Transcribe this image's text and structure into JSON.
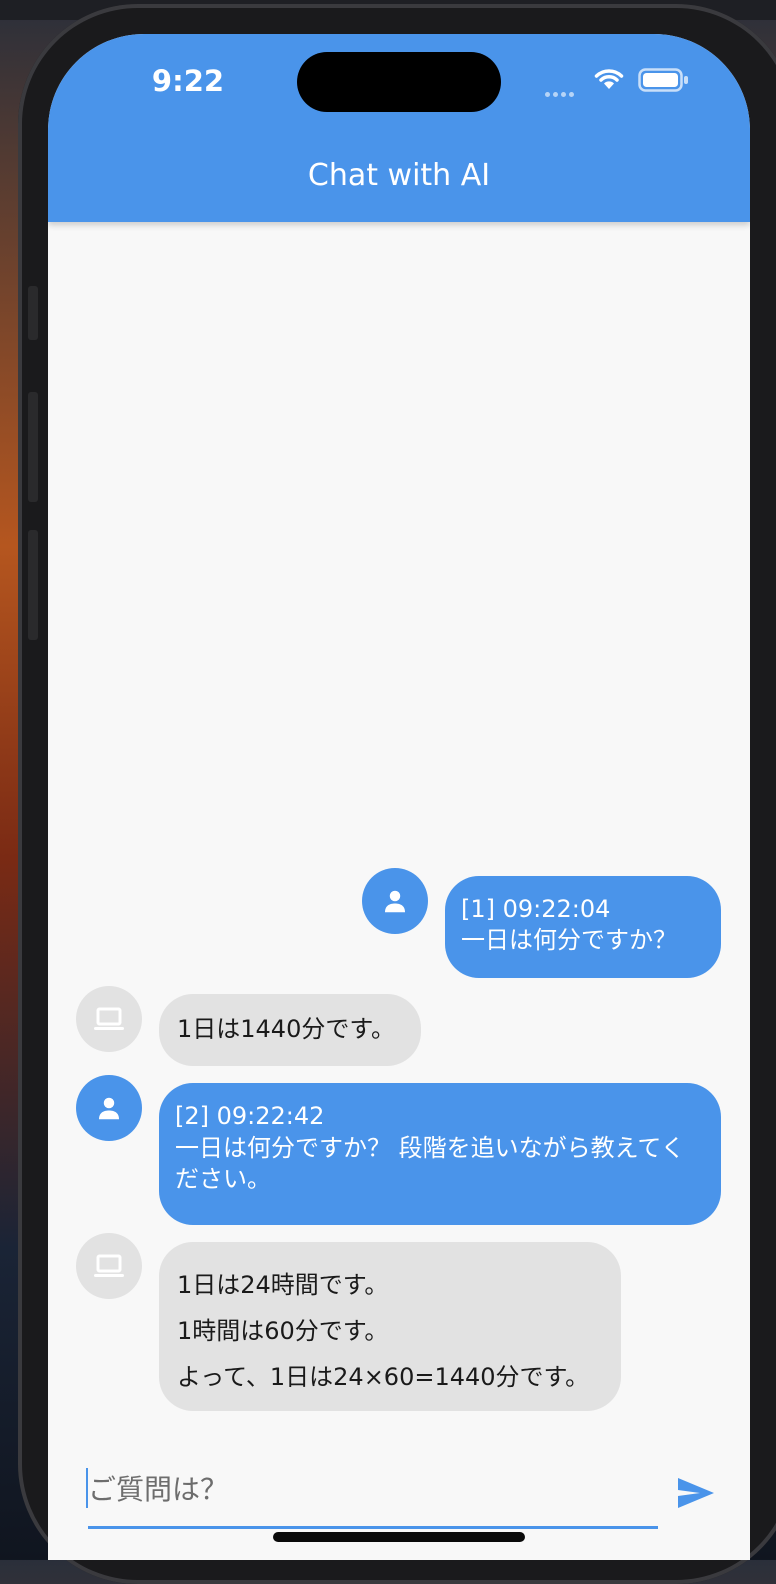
{
  "status_bar": {
    "time": "9:22"
  },
  "app_bar": {
    "title": "Chat with AI"
  },
  "messages": [
    {
      "sender": "user",
      "icon": "person-icon",
      "header": "[1] 09:22:04",
      "text": " 一日は何分ですか？"
    },
    {
      "sender": "ai",
      "icon": "laptop-icon",
      "lines": [
        "1日は1440分です。"
      ]
    },
    {
      "sender": "user",
      "icon": "person-icon",
      "header": "[2] 09:22:42",
      "text": " 一日は何分ですか？ 段階を追いながら教えてください。"
    },
    {
      "sender": "ai",
      "icon": "laptop-icon",
      "lines": [
        "1日は24時間です。",
        "1時間は60分です。",
        "よって、1日は24×60=1440分です。"
      ]
    }
  ],
  "composer": {
    "placeholder": "ご質問は？",
    "value": "",
    "send_icon": "send-icon"
  },
  "colors": {
    "primary": "#4a94ea",
    "ai_bubble": "#e2e2e2",
    "background": "#f8f8f8"
  }
}
